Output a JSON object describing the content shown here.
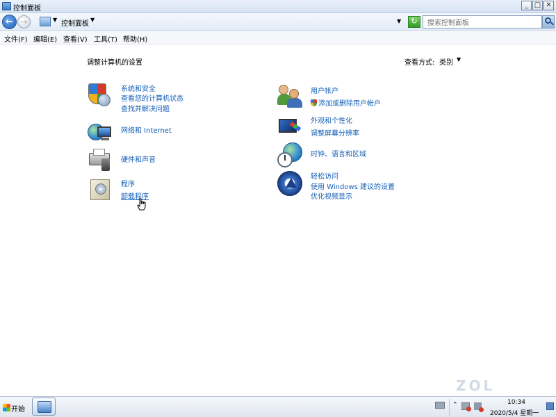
{
  "window": {
    "title": "控制面板",
    "buttons": {
      "minimize": "0",
      "maximize": "□",
      "close": "✕"
    }
  },
  "address_bar": {
    "breadcrumb": "控制面板",
    "search_placeholder": "搜索控制面板",
    "back_icon": "back-arrow-icon",
    "forward_icon": "forward-arrow-icon"
  },
  "menu": {
    "items": [
      "文件(F)",
      "编辑(E)",
      "查看(V)",
      "工具(T)",
      "帮助(H)"
    ]
  },
  "content": {
    "heading": "调整计算机的设置",
    "view_by_label": "查看方式:",
    "view_by_value": "类别",
    "categories_left": [
      {
        "title": "系统和安全",
        "links": [
          "查看您的计算机状态",
          "查找并解决问题"
        ],
        "icon": "shield-icon"
      },
      {
        "title": "网络和 Internet",
        "links": [],
        "icon": "network-icon"
      },
      {
        "title": "硬件和声音",
        "links": [],
        "icon": "printer-icon"
      },
      {
        "title": "程序",
        "links": [
          "卸载程序"
        ],
        "icon": "programs-icon"
      }
    ],
    "categories_right": [
      {
        "title": "用户帐户",
        "links": [
          "添加或删除用户帐户"
        ],
        "icon": "users-icon"
      },
      {
        "title": "外观和个性化",
        "links": [
          "调整屏幕分辨率"
        ],
        "icon": "appearance-icon"
      },
      {
        "title": "时钟、语言和区域",
        "links": [],
        "icon": "clock-globe-icon"
      },
      {
        "title": "轻松访问",
        "links": [
          "使用 Windows 建议的设置",
          "优化视频显示"
        ],
        "icon": "ease-of-access-icon"
      }
    ]
  },
  "taskbar": {
    "start_label": "开始",
    "time": "10:34",
    "date": "2020/5/4 星期一"
  },
  "watermark": "ZOL"
}
